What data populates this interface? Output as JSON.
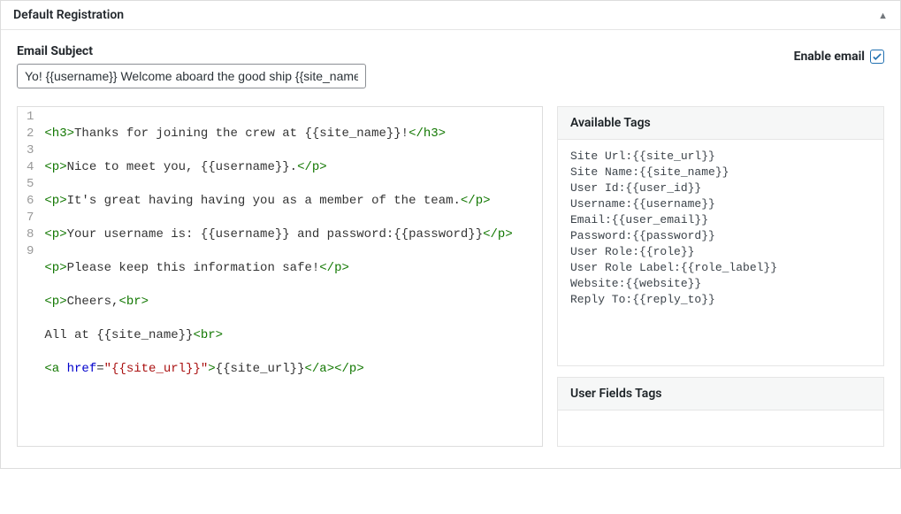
{
  "panel": {
    "title": "Default Registration"
  },
  "subject": {
    "label": "Email Subject",
    "value": "Yo! {{username}} Welcome aboard the good ship {{site_name}}"
  },
  "enable": {
    "label": "Enable email",
    "checked": true
  },
  "code": {
    "lines": [
      "1",
      "2",
      "3",
      "4",
      "5",
      "6",
      "7",
      "8",
      "9"
    ],
    "l1_open": "<h3>",
    "l1_text": "Thanks for joining the crew at {{site_name}}!",
    "l1_close": "</h3>",
    "l2_open": "<p>",
    "l2_text": "Nice to meet you, {{username}}.",
    "l2_close": "</p>",
    "l3_open": "<p>",
    "l3_text": "It's great having having you as a member of the team.",
    "l3_close": "</p>",
    "l4_open": "<p>",
    "l4_text": "Your username is: {{username}} and password:{{password}}",
    "l4_close": "</p>",
    "l5_open": "<p>",
    "l5_text": "Please keep this information safe!",
    "l5_close": "</p>",
    "l6_open": "<p>",
    "l6_text": "Cheers,",
    "l6_br": "<br>",
    "l7_text": "All at {{site_name}}",
    "l7_br": "<br>",
    "l8_a_open": "<a ",
    "l8_a_attr": "href",
    "l8_eq": "=",
    "l8_a_val": "\"{{site_url}}\"",
    "l8_a_end": ">",
    "l8_text": "{{site_url}}",
    "l8_a_close": "</a>",
    "l8_p_close": "</p>"
  },
  "available_tags": {
    "heading": "Available Tags",
    "items": [
      "Site Url:{{site_url}}",
      "Site Name:{{site_name}}",
      "User Id:{{user_id}}",
      "Username:{{username}}",
      "Email:{{user_email}}",
      "Password:{{password}}",
      "User Role:{{role}}",
      "User Role Label:{{role_label}}",
      "Website:{{website}}",
      "Reply To:{{reply_to}}"
    ]
  },
  "user_fields": {
    "heading": "User Fields Tags"
  }
}
